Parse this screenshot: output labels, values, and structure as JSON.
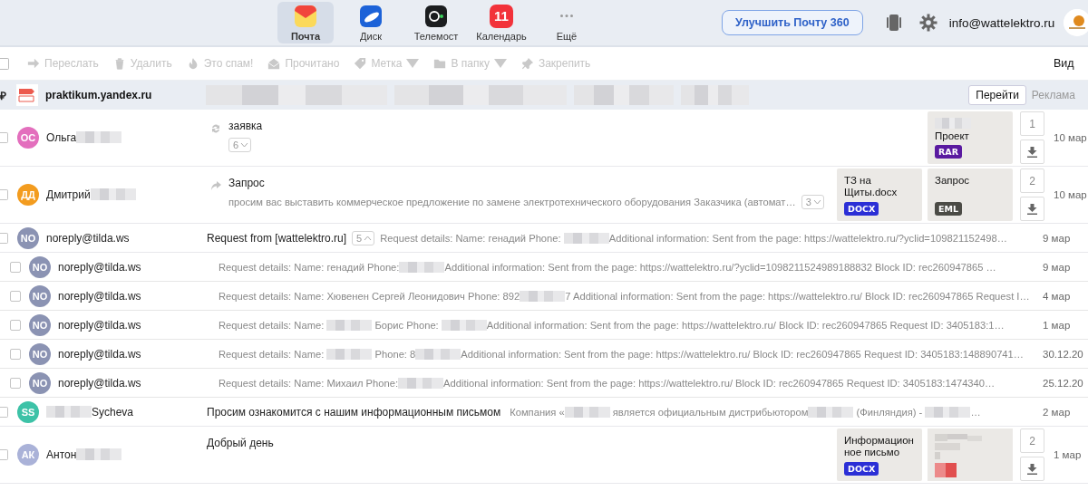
{
  "apps": [
    {
      "kind": "mail",
      "label": "Почта",
      "selected": true
    },
    {
      "kind": "disk",
      "label": "Диск",
      "selected": false
    },
    {
      "kind": "telemost",
      "label": "Телемост",
      "selected": false
    },
    {
      "kind": "calendar",
      "label": "Календарь",
      "badge": "11",
      "selected": false
    },
    {
      "kind": "more",
      "label": "Ещё",
      "selected": false
    }
  ],
  "upgrade_button": "Улучшить Почту 360",
  "account": "info@wattelektro.ru",
  "toolbar": {
    "actions": [
      {
        "kind": "forward",
        "label": "Переслать",
        "disabled": true,
        "dropdown": false
      },
      {
        "kind": "delete",
        "label": "Удалить",
        "disabled": true,
        "dropdown": false
      },
      {
        "kind": "spam",
        "label": "Это спам!",
        "disabled": true,
        "dropdown": false
      },
      {
        "kind": "read",
        "label": "Прочитано",
        "disabled": true,
        "dropdown": false
      },
      {
        "kind": "label",
        "label": "Метка",
        "disabled": true,
        "dropdown": true
      },
      {
        "kind": "folder",
        "label": "В папку",
        "disabled": true,
        "dropdown": true
      },
      {
        "kind": "pin",
        "label": "Закрепить",
        "disabled": true,
        "dropdown": false
      }
    ],
    "view": "Вид",
    "select_all_checked": false
  },
  "ad": {
    "currency": "₽",
    "domain": "praktikum.yandex.ru",
    "button": "Перейти",
    "label": "Реклама"
  },
  "messages": [
    {
      "kind": "full",
      "checked": false,
      "initials": "ОС",
      "color": "#e36fbd",
      "sender": [
        "Ольга",
        {
          "kind": "redacted"
        }
      ],
      "answered": true,
      "forwarded": false,
      "subject": "заявка",
      "thread": {
        "count": "6",
        "expanded": false
      },
      "attachments": [
        {
          "kind": "file",
          "name": [
            {
              "kind": "redacted"
            },
            "Проект"
          ],
          "type": "RAR"
        }
      ],
      "attachment_count": "1",
      "date": "10 мар"
    },
    {
      "kind": "full",
      "checked": false,
      "initials": "ДД",
      "color": "#f39c1f",
      "sender": [
        "Дмитрий",
        {
          "kind": "redacted"
        }
      ],
      "answered": false,
      "forwarded": true,
      "subject": "Запрос",
      "snippet": [
        "просим вас выставить коммерческое предложение по замене электротехнического оборудования Заказчика (автомат…"
      ],
      "thread": {
        "count": "3",
        "expanded": false
      },
      "attachments": [
        {
          "kind": "file",
          "name": [
            "ТЗ на Щиты.docx"
          ],
          "type": "DOCX"
        },
        {
          "kind": "file",
          "name": [
            "Запрос"
          ],
          "type": "EML"
        }
      ],
      "attachment_count": "2",
      "date": "10 мар"
    },
    {
      "kind": "thread",
      "checked": false,
      "initials": "NO",
      "color": "#8b93b3",
      "sender": [
        "noreply@tilda.ws"
      ],
      "subject": "Request from [wattelektro.ru]",
      "thread": {
        "count": "5",
        "expanded": true
      },
      "snippet": [
        "Request details: Name: генадий Phone: ",
        {
          "kind": "redacted"
        },
        "Additional information: Sent from the page: https://wattelektro.ru/?yclid=109821152498…"
      ],
      "date": "9 мар",
      "children": [
        {
          "kind": "child",
          "checked": false,
          "initials": "NO",
          "color": "#8b93b3",
          "sender": [
            "noreply@tilda.ws"
          ],
          "snippet": [
            "Request details: Name: генадий Phone:",
            {
              "kind": "redacted"
            },
            "Additional information: Sent from the page: https://wattelektro.ru/?yclid=1098211524989188832 Block ID: rec260947865 …"
          ],
          "date": "9 мар"
        },
        {
          "kind": "child",
          "checked": false,
          "initials": "NO",
          "color": "#8b93b3",
          "sender": [
            "noreply@tilda.ws"
          ],
          "snippet": [
            "Request details: Name: Хювенен Сергей Леонидович Phone: 892",
            {
              "kind": "redacted"
            },
            "7 Additional information: Sent from the page: https://wattelektro.ru/ Block ID: rec260947865 Request I…"
          ],
          "date": "4 мар"
        },
        {
          "kind": "child",
          "checked": false,
          "initials": "NO",
          "color": "#8b93b3",
          "sender": [
            "noreply@tilda.ws"
          ],
          "snippet": [
            "Request details: Name: ",
            {
              "kind": "redacted"
            },
            " Борис Phone: ",
            {
              "kind": "redacted"
            },
            "Additional information: Sent from the page: https://wattelektro.ru/ Block ID: rec260947865 Request ID: 3405183:1…"
          ],
          "date": "1 мар"
        },
        {
          "kind": "child",
          "checked": false,
          "initials": "NO",
          "color": "#8b93b3",
          "sender": [
            "noreply@tilda.ws"
          ],
          "snippet": [
            "Request details: Name: ",
            {
              "kind": "redacted"
            },
            " Phone: 8",
            {
              "kind": "redacted"
            },
            "Additional information: Sent from the page: https://wattelektro.ru/ Block ID: rec260947865 Request ID: 3405183:148890741…"
          ],
          "date": "30.12.20"
        },
        {
          "kind": "child",
          "checked": false,
          "initials": "NO",
          "color": "#8b93b3",
          "sender": [
            "noreply@tilda.ws"
          ],
          "snippet": [
            "Request details: Name: Михаил Phone:",
            {
              "kind": "redacted"
            },
            "Additional information: Sent from the page: https://wattelektro.ru/ Block ID: rec260947865 Request ID: 3405183:1474340…"
          ],
          "date": "25.12.20"
        }
      ]
    },
    {
      "kind": "simple",
      "checked": false,
      "initials": "SS",
      "color": "#3dc2a7",
      "sender": [
        {
          "kind": "redacted"
        },
        "Sycheva"
      ],
      "subject": "Просим ознакомится с нашим информационным письмом",
      "snippet": [
        "Компания «",
        {
          "kind": "redacted"
        },
        " является официальным дистрибьютором",
        {
          "kind": "redacted"
        },
        " (Финляндия) - ",
        {
          "kind": "redacted"
        },
        "…"
      ],
      "date": "2 мар"
    },
    {
      "kind": "full",
      "checked": false,
      "initials": "АК",
      "color": "#aab2d8",
      "sender": [
        "Антон",
        {
          "kind": "redacted"
        }
      ],
      "subject": "Добрый день",
      "attachments": [
        {
          "kind": "file",
          "name": [
            "Информационное письмо"
          ],
          "type": "DOCX"
        },
        {
          "kind": "picture"
        }
      ],
      "attachment_count": "2",
      "date": "1 мар"
    }
  ]
}
